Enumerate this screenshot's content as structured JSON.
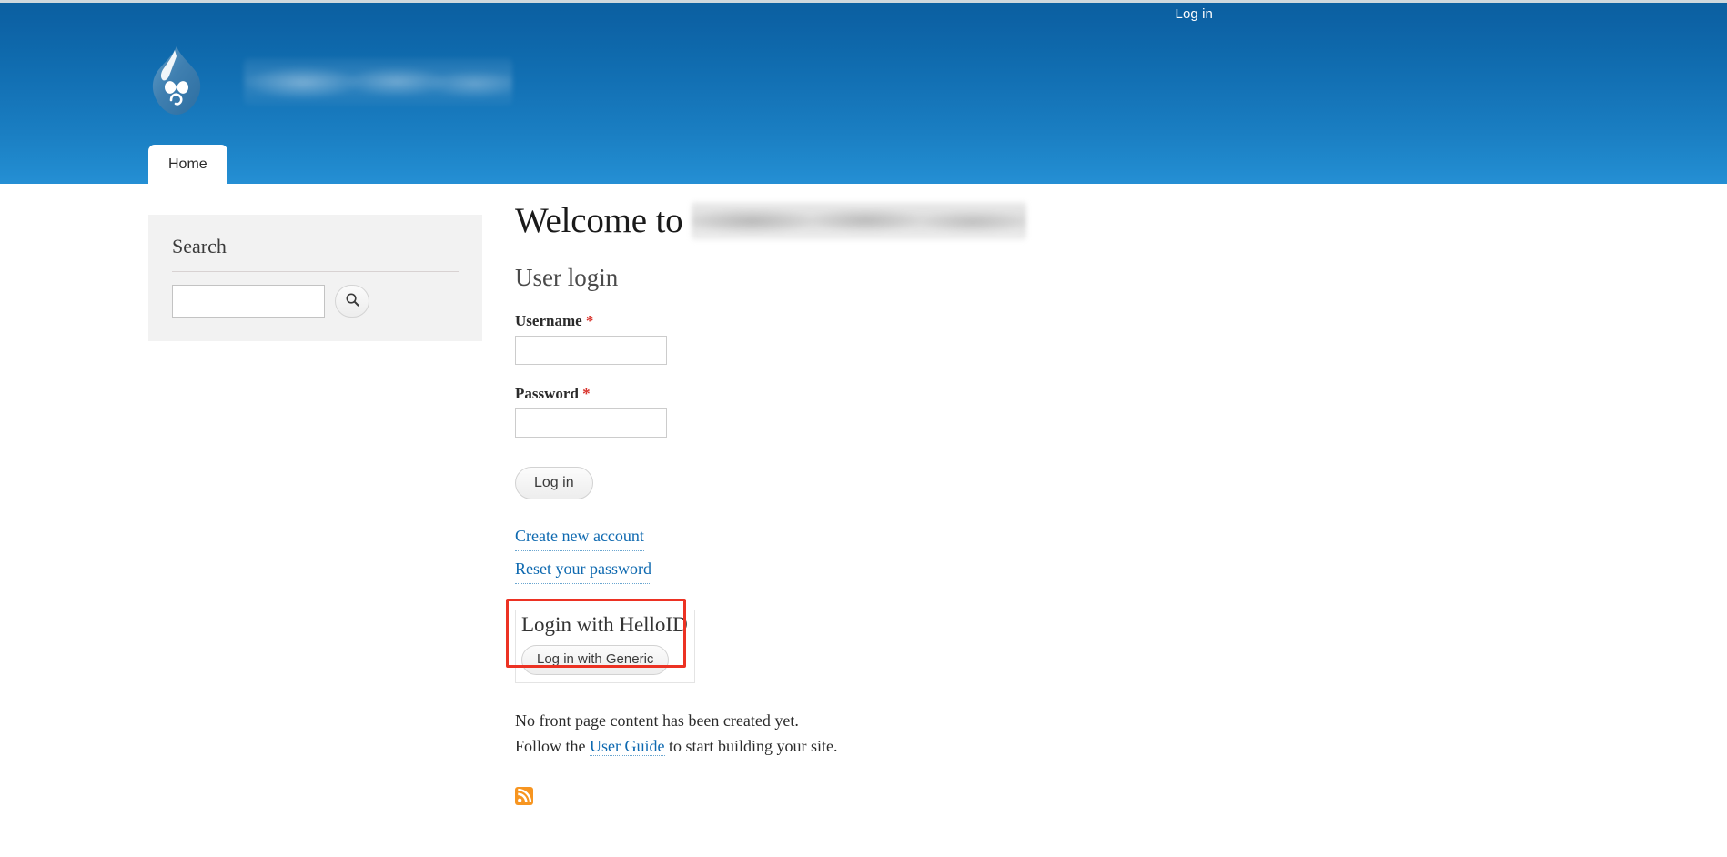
{
  "site": {
    "logo_icon": "drupal-droplet-icon",
    "site_name_redacted": true,
    "top_line_color": "#cfd8dd",
    "header_gradient_top": "#0b5fa0",
    "header_gradient_bottom": "#258fd4"
  },
  "account_nav": {
    "login_label": "Log in"
  },
  "main_nav": {
    "tabs": [
      {
        "label": "Home",
        "active": true
      }
    ]
  },
  "sidebar": {
    "search_block": {
      "title": "Search",
      "input_value": "",
      "input_placeholder": "",
      "submit_icon": "search-icon"
    }
  },
  "main": {
    "page_title_prefix": "Welcome to",
    "page_title_redacted": true,
    "user_login": {
      "heading": "User login",
      "fields": [
        {
          "name": "username",
          "label": "Username",
          "required_marker": "*",
          "value": "",
          "placeholder": ""
        },
        {
          "name": "password",
          "label": "Password",
          "required_marker": "*",
          "value": "",
          "placeholder": ""
        }
      ],
      "submit_label": "Log in",
      "links": [
        {
          "label": "Create new account"
        },
        {
          "label": "Reset your password"
        }
      ]
    },
    "helloid_block": {
      "title": "Login with HelloID",
      "button_label": "Log in with Generic",
      "highlight_color": "#ec3223",
      "highlighted": true
    },
    "front_page_note": {
      "line1": "No front page content has been created yet.",
      "line2_prefix": "Follow the ",
      "line2_link": "User Guide",
      "line2_suffix": " to start building your site."
    },
    "feed_icon": {
      "name": "rss-feed-icon",
      "color": "#f79520"
    }
  }
}
